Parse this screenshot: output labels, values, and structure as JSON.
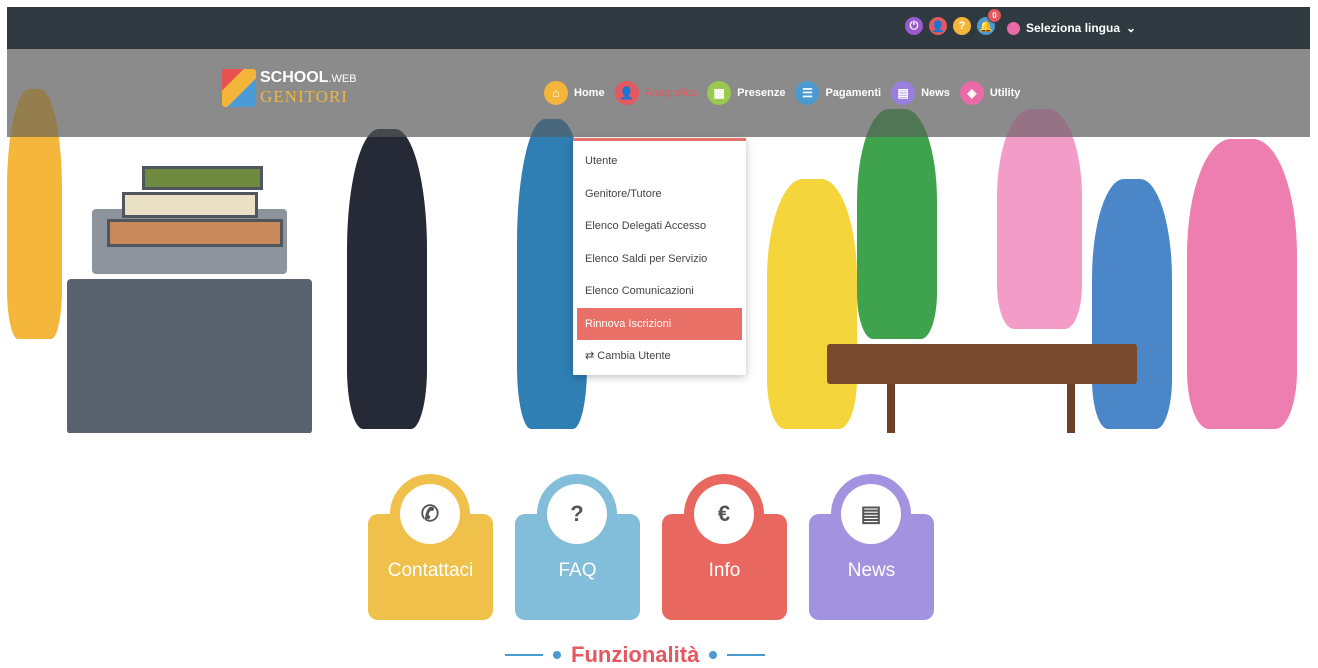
{
  "topbar": {
    "icons": [
      {
        "name": "power-icon",
        "glyph": "⏻",
        "color": "#9b59d0"
      },
      {
        "name": "user-icon",
        "glyph": "👤",
        "color": "#e5585f"
      },
      {
        "name": "help-icon",
        "glyph": "?",
        "color": "#f3b63a"
      },
      {
        "name": "bell-icon",
        "glyph": "🔔",
        "color": "#4a9ad0"
      }
    ],
    "notification_count": "0",
    "language_label": "Seleziona lingua",
    "language_chevron": "⌄"
  },
  "logo": {
    "school": "SCHOOL",
    "web": ".WEB",
    "sub": "GENITORI"
  },
  "nav": {
    "items": [
      {
        "label": "Home",
        "icon": "home-icon",
        "glyph": "⌂",
        "color": "#f3b63a"
      },
      {
        "label": "Anagrafica",
        "icon": "person-icon",
        "glyph": "👤",
        "color": "#e5585f"
      },
      {
        "label": "Presenze",
        "icon": "calendar-icon",
        "glyph": "▦",
        "color": "#9bc84f"
      },
      {
        "label": "Pagamenti",
        "icon": "list-icon",
        "glyph": "☰",
        "color": "#4a9ad0"
      },
      {
        "label": "News",
        "icon": "newspaper-icon",
        "glyph": "▤",
        "color": "#9b7fe0"
      },
      {
        "label": "Utility",
        "icon": "code-icon",
        "glyph": "◈",
        "color": "#e86ba8"
      }
    ]
  },
  "dropdown": {
    "items": [
      "Utente",
      "Genitore/Tutore",
      "Elenco Delegati Accesso",
      "Elenco Saldi per Servizio",
      "Elenco Comunicazioni",
      "Rinnova Iscrizioni",
      "⇄ Cambia Utente"
    ]
  },
  "cards": [
    {
      "label": "Contattaci",
      "icon": "phone-icon",
      "glyph": "✆",
      "color": "#efc04a"
    },
    {
      "label": "FAQ",
      "icon": "question-icon",
      "glyph": "?",
      "color": "#82bdd9"
    },
    {
      "label": "Info",
      "icon": "euro-icon",
      "glyph": "€",
      "color": "#e8685f"
    },
    {
      "label": "News",
      "icon": "newspaper-icon",
      "glyph": "▤",
      "color": "#a292e0"
    }
  ],
  "section": {
    "title": "Funzionalità"
  }
}
